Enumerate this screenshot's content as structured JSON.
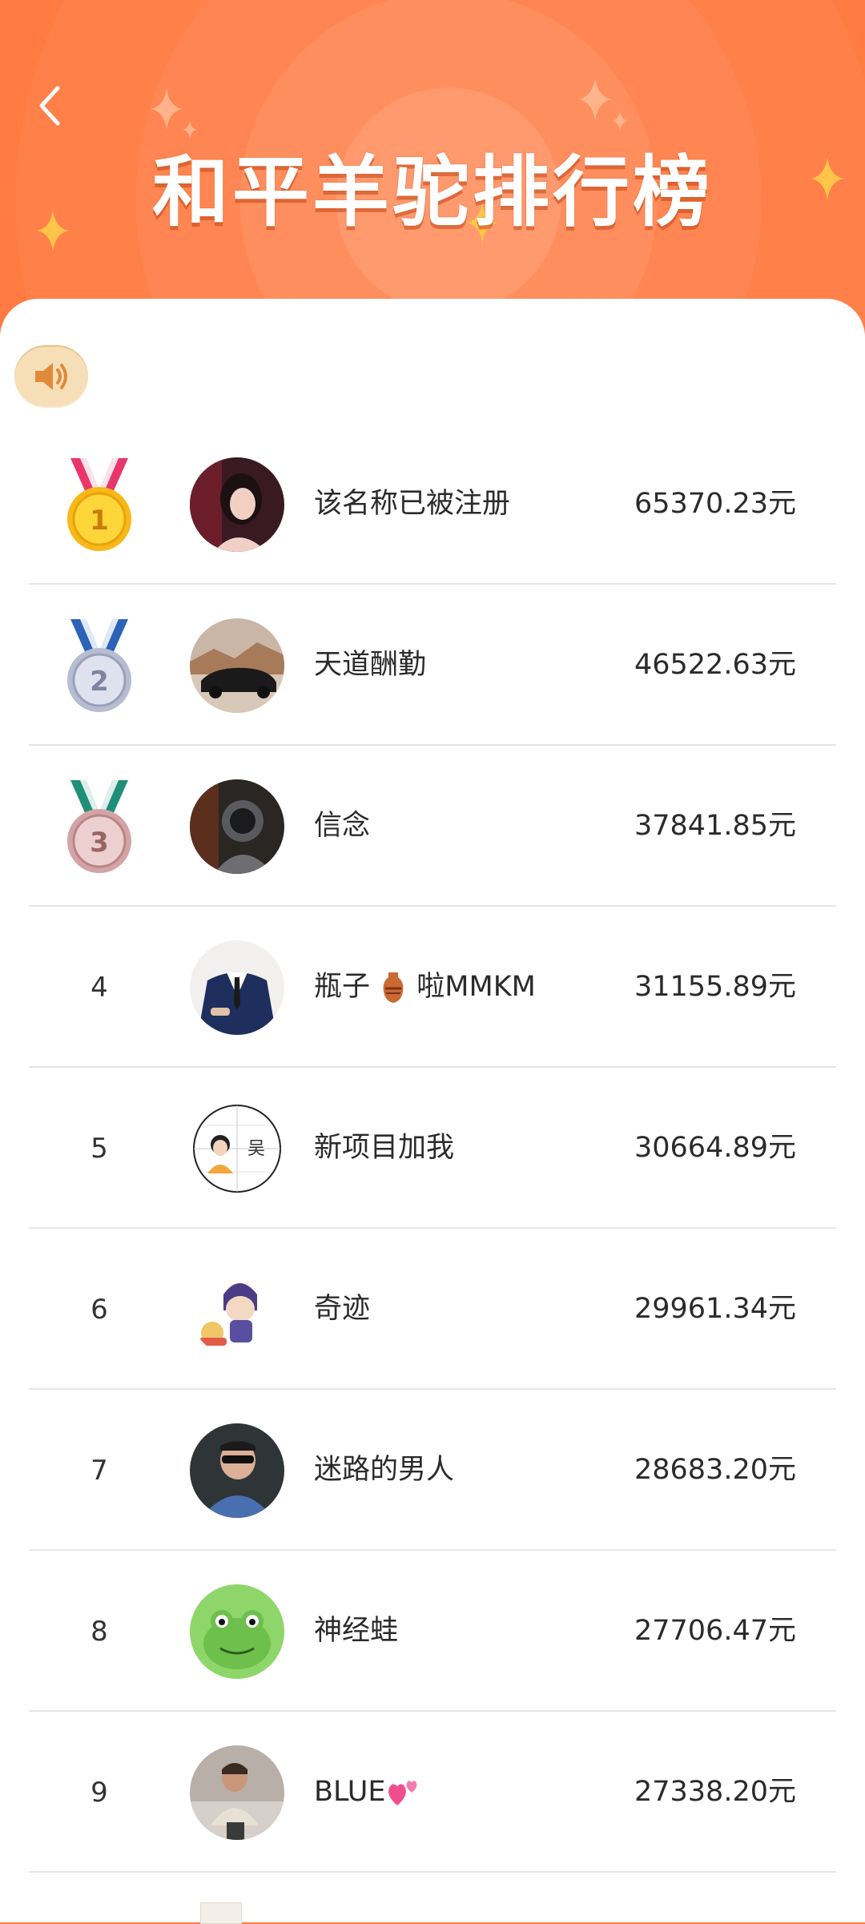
{
  "header": {
    "title": "和平羊驼排行榜",
    "accent_color": "#ff7b42"
  },
  "sound_button": {
    "icon": "speaker-icon"
  },
  "leaderboard": [
    {
      "rank": "1",
      "medal": "gold",
      "name": "该名称已被注册",
      "amount": "65370.23元"
    },
    {
      "rank": "2",
      "medal": "silver",
      "name": "天道酬勤",
      "amount": "46522.63元"
    },
    {
      "rank": "3",
      "medal": "bronze",
      "name": "信念",
      "amount": "37841.85元"
    },
    {
      "rank": "4",
      "name": "瓶子",
      "name_suffix": "啦MMKM",
      "name_emoji": "amphora-emoji",
      "amount": "31155.89元"
    },
    {
      "rank": "5",
      "name": "新项目加我",
      "amount": "30664.89元"
    },
    {
      "rank": "6",
      "name": "奇迹",
      "amount": "29961.34元"
    },
    {
      "rank": "7",
      "name": "迷路的男人",
      "amount": "28683.20元"
    },
    {
      "rank": "8",
      "name": "神经蛙",
      "amount": "27706.47元"
    },
    {
      "rank": "9",
      "name": "BLUE",
      "name_emoji": "two-hearts-emoji",
      "amount": "27338.20元"
    }
  ]
}
